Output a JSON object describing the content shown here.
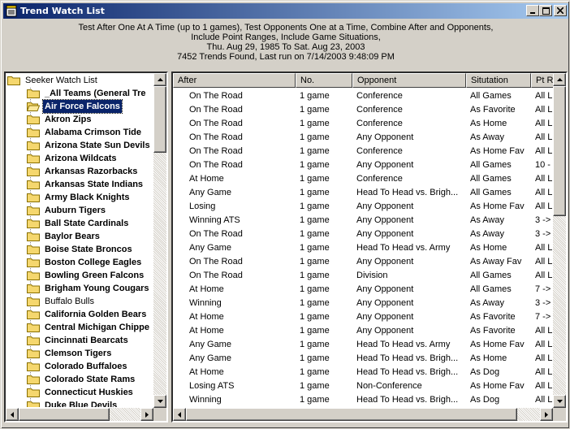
{
  "window": {
    "title": "Trend Watch List",
    "buttons": {
      "minimize": "minimize",
      "maximize": "maximize",
      "close": "close"
    }
  },
  "info": {
    "lines": [
      "Test After One At A Time (up to 1 games), Test Opponents One at a Time, Combine After and Opponents,",
      "Include Point Ranges, Include Game Situations,",
      "Thu. Aug 29, 1985 To Sat. Aug 23, 2003",
      "7452 Trends Found, Last run on 7/14/2003 9:48:09 PM"
    ]
  },
  "tree": {
    "root": "Seeker Watch List",
    "items": [
      {
        "label": "_All Teams (General Tre",
        "bold": true,
        "selected": false
      },
      {
        "label": "Air Force Falcons",
        "bold": true,
        "selected": true
      },
      {
        "label": "Akron Zips",
        "bold": true,
        "selected": false
      },
      {
        "label": "Alabama Crimson Tide",
        "bold": true,
        "selected": false
      },
      {
        "label": "Arizona State Sun Devils",
        "bold": true,
        "selected": false
      },
      {
        "label": "Arizona Wildcats",
        "bold": true,
        "selected": false
      },
      {
        "label": "Arkansas Razorbacks",
        "bold": true,
        "selected": false
      },
      {
        "label": "Arkansas State Indians",
        "bold": true,
        "selected": false
      },
      {
        "label": "Army Black Knights",
        "bold": true,
        "selected": false
      },
      {
        "label": "Auburn Tigers",
        "bold": true,
        "selected": false
      },
      {
        "label": "Ball State Cardinals",
        "bold": true,
        "selected": false
      },
      {
        "label": "Baylor Bears",
        "bold": true,
        "selected": false
      },
      {
        "label": "Boise State Broncos",
        "bold": true,
        "selected": false
      },
      {
        "label": "Boston College Eagles",
        "bold": true,
        "selected": false
      },
      {
        "label": "Bowling Green Falcons",
        "bold": true,
        "selected": false
      },
      {
        "label": "Brigham Young Cougars",
        "bold": true,
        "selected": false
      },
      {
        "label": "Buffalo Bulls",
        "bold": false,
        "selected": false
      },
      {
        "label": "California Golden Bears",
        "bold": true,
        "selected": false
      },
      {
        "label": "Central Michigan Chippe",
        "bold": true,
        "selected": false
      },
      {
        "label": "Cincinnati Bearcats",
        "bold": true,
        "selected": false
      },
      {
        "label": "Clemson Tigers",
        "bold": true,
        "selected": false
      },
      {
        "label": "Colorado Buffaloes",
        "bold": true,
        "selected": false
      },
      {
        "label": "Colorado State Rams",
        "bold": true,
        "selected": false
      },
      {
        "label": "Connecticut Huskies",
        "bold": true,
        "selected": false
      },
      {
        "label": "Duke Blue Devils",
        "bold": true,
        "selected": false
      }
    ]
  },
  "list": {
    "columns": [
      "After",
      "No.",
      "Opponent",
      "Situtation",
      "Pt R"
    ],
    "rows": [
      [
        "On The Road",
        "1 game",
        "Conference",
        "All Games",
        "All L"
      ],
      [
        "On The Road",
        "1 game",
        "Conference",
        "As Favorite",
        "All L"
      ],
      [
        "On The Road",
        "1 game",
        "Conference",
        "As Home",
        "All L"
      ],
      [
        "On The Road",
        "1 game",
        "Any Opponent",
        "As Away",
        "All L"
      ],
      [
        "On The Road",
        "1 game",
        "Conference",
        "As Home Fav",
        "All L"
      ],
      [
        "On The Road",
        "1 game",
        "Any Opponent",
        "All Games",
        "10 -"
      ],
      [
        "At Home",
        "1 game",
        "Conference",
        "All Games",
        "All L"
      ],
      [
        "Any Game",
        "1 game",
        "Head To Head vs. Brigh...",
        "All Games",
        "All L"
      ],
      [
        "Losing",
        "1 game",
        "Any Opponent",
        "As Home Fav",
        "All L"
      ],
      [
        "Winning ATS",
        "1 game",
        "Any Opponent",
        "As Away",
        "3 ->"
      ],
      [
        "On The Road",
        "1 game",
        "Any Opponent",
        "As Away",
        "3 ->"
      ],
      [
        "Any Game",
        "1 game",
        "Head To Head vs. Army",
        "As Home",
        "All L"
      ],
      [
        "On The Road",
        "1 game",
        "Any Opponent",
        "As Away Fav",
        "All L"
      ],
      [
        "On The Road",
        "1 game",
        "Division",
        "All Games",
        "All L"
      ],
      [
        "At Home",
        "1 game",
        "Any Opponent",
        "All Games",
        "7 ->"
      ],
      [
        "Winning",
        "1 game",
        "Any Opponent",
        "As Away",
        "3 ->"
      ],
      [
        "At Home",
        "1 game",
        "Any Opponent",
        "As Favorite",
        "7 ->"
      ],
      [
        "At Home",
        "1 game",
        "Any Opponent",
        "As Favorite",
        "All L"
      ],
      [
        "Any Game",
        "1 game",
        "Head To Head vs. Army",
        "As Home Fav",
        "All L"
      ],
      [
        "Any Game",
        "1 game",
        "Head To Head vs. Brigh...",
        "As Home",
        "All L"
      ],
      [
        "At Home",
        "1 game",
        "Head To Head vs. Brigh...",
        "As Dog",
        "All L"
      ],
      [
        "Losing ATS",
        "1 game",
        "Non-Conference",
        "As Home Fav",
        "All L"
      ],
      [
        "Winning",
        "1 game",
        "Head To Head vs. Brigh...",
        "As Dog",
        "All L"
      ]
    ]
  },
  "colors": {
    "selection": "#0a246a",
    "titlebar_start": "#0a246a",
    "titlebar_end": "#a6caf0",
    "folder": "#f5d76e"
  }
}
